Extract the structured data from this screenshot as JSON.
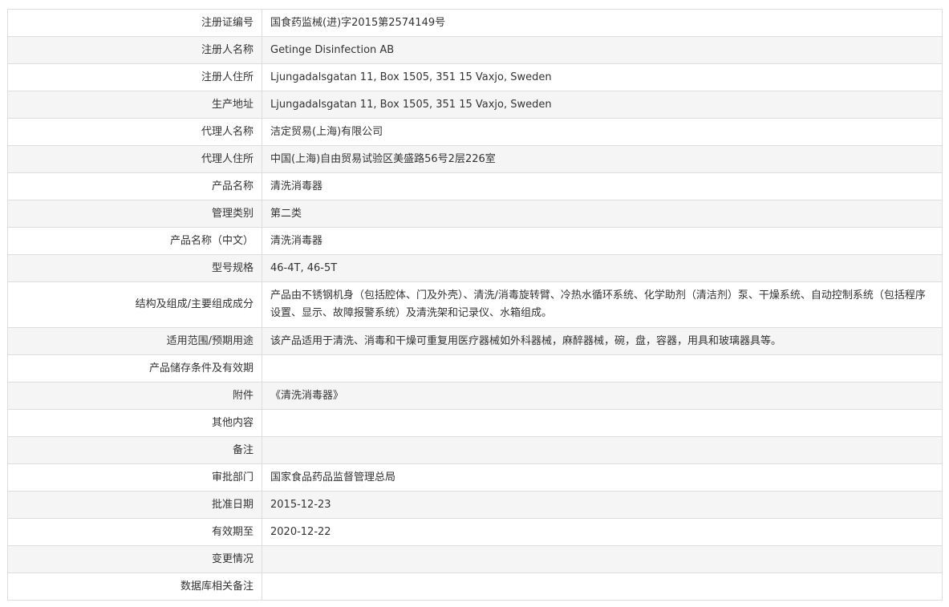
{
  "rows": [
    {
      "label": "注册证编号",
      "value": "国食药监械(进)字2015第2574149号"
    },
    {
      "label": "注册人名称",
      "value": "Getinge Disinfection AB"
    },
    {
      "label": "注册人住所",
      "value": "Ljungadalsgatan 11, Box 1505, 351 15 Vaxjo, Sweden"
    },
    {
      "label": "生产地址",
      "value": "Ljungadalsgatan 11, Box 1505, 351 15 Vaxjo, Sweden"
    },
    {
      "label": "代理人名称",
      "value": "洁定贸易(上海)有限公司"
    },
    {
      "label": "代理人住所",
      "value": "中国(上海)自由贸易试验区美盛路56号2层226室"
    },
    {
      "label": "产品名称",
      "value": "清洗消毒器"
    },
    {
      "label": "管理类别",
      "value": "第二类"
    },
    {
      "label": "产品名称（中文）",
      "value": "清洗消毒器"
    },
    {
      "label": "型号规格",
      "value": "46-4T, 46-5T"
    },
    {
      "label": "结构及组成/主要组成成分",
      "value": "产品由不锈钢机身（包括腔体、门及外壳）、清洗/消毒旋转臂、冷热水循环系统、化学助剂（清洁剂）泵、干燥系统、自动控制系统（包括程序设置、显示、故障报警系统）及清洗架和记录仪、水箱组成。"
    },
    {
      "label": "适用范围/预期用途",
      "value": "该产品适用于清洗、消毒和干燥可重复用医疗器械如外科器械，麻醉器械，碗，盘，容器，用具和玻璃器具等。"
    },
    {
      "label": "产品储存条件及有效期",
      "value": ""
    },
    {
      "label": "附件",
      "value": "《清洗消毒器》"
    },
    {
      "label": "其他内容",
      "value": ""
    },
    {
      "label": "备注",
      "value": ""
    },
    {
      "label": "审批部门",
      "value": "国家食品药品监督管理总局"
    },
    {
      "label": "批准日期",
      "value": "2015-12-23"
    },
    {
      "label": "有效期至",
      "value": "2020-12-22"
    },
    {
      "label": "变更情况",
      "value": ""
    },
    {
      "label": "数据库相关备注",
      "value": ""
    }
  ]
}
